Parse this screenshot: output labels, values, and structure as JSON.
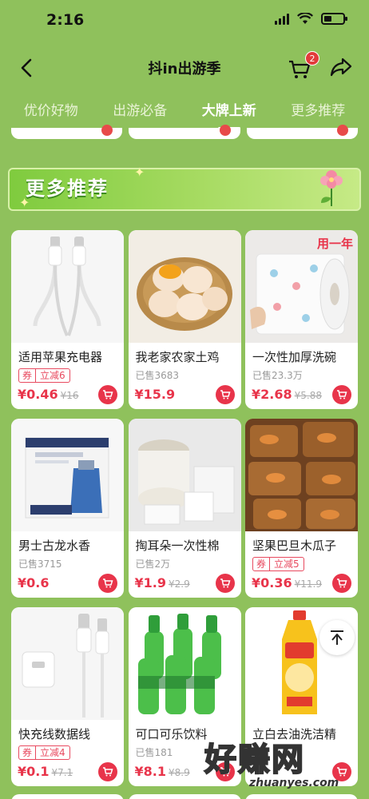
{
  "status": {
    "time": "2:16"
  },
  "nav": {
    "title": "抖in出游季",
    "cart_count": "2"
  },
  "tabs": [
    {
      "label": "优价好物",
      "active": false
    },
    {
      "label": "出游必备",
      "active": false
    },
    {
      "label": "大牌上新",
      "active": true
    },
    {
      "label": "更多推荐",
      "active": false
    }
  ],
  "banner": {
    "title": "更多推荐"
  },
  "products": [
    {
      "title": "适用苹果充电器",
      "coupon_tag": "券",
      "coupon_value": "立减6",
      "sold": "",
      "price": "¥0.46",
      "original": "¥16",
      "image": "charging-cable-image"
    },
    {
      "title": "我老家农家土鸡",
      "coupon_tag": "",
      "coupon_value": "",
      "sold": "已售3683",
      "price": "¥15.9",
      "original": "",
      "image": "eggs-basket-image"
    },
    {
      "title": "一次性加厚洗碗",
      "coupon_tag": "",
      "coupon_value": "",
      "sold": "已售23.3万",
      "price": "¥2.68",
      "original": "¥5.88",
      "image": "paper-towel-roll-image",
      "badge": "用一年"
    },
    {
      "title": "男士古龙水香",
      "coupon_tag": "",
      "coupon_value": "",
      "sold": "已售3715",
      "price": "¥0.6",
      "original": "",
      "image": "cologne-soap-box-image"
    },
    {
      "title": "掏耳朵一次性棉",
      "coupon_tag": "",
      "coupon_value": "",
      "sold": "已售2万",
      "price": "¥1.9",
      "original": "¥2.9",
      "image": "cotton-swabs-image"
    },
    {
      "title": "坚果巴旦木瓜子",
      "coupon_tag": "券",
      "coupon_value": "立减5",
      "sold": "",
      "price": "¥0.36",
      "original": "¥11.9",
      "image": "nut-brittle-image"
    },
    {
      "title": "快充线数据线",
      "coupon_tag": "券",
      "coupon_value": "立减4",
      "sold": "",
      "price": "¥0.1",
      "original": "¥7.1",
      "image": "charger-adapter-image"
    },
    {
      "title": "可口可乐饮料",
      "coupon_tag": "",
      "coupon_value": "",
      "sold": "已售181",
      "price": "¥8.1",
      "original": "¥8.9",
      "image": "soda-bottles-image"
    },
    {
      "title": "立白去油洗洁精",
      "coupon_tag": "",
      "coupon_value": "",
      "sold": "",
      "price": "",
      "original": "",
      "image": "dish-soap-bottle-image"
    }
  ],
  "watermark": {
    "big": "好赚网",
    "small": "zhuanyes.com"
  },
  "colors": {
    "background": "#8fc15c",
    "price": "#e8344a",
    "accent": "#7fcb3e"
  }
}
